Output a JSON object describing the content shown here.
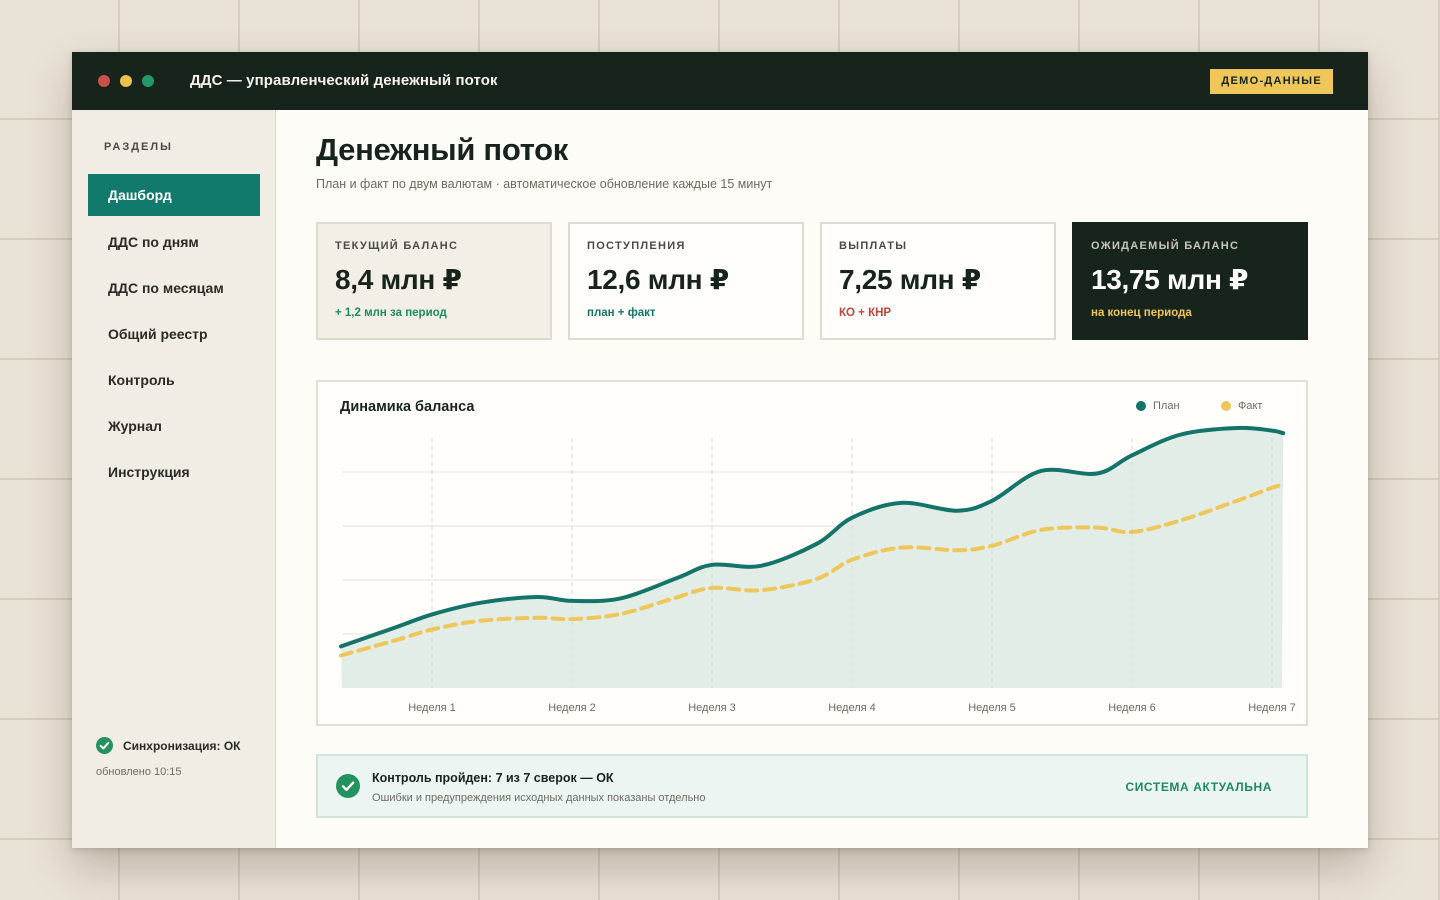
{
  "window": {
    "title": "ДДС — управленческий денежный поток",
    "badge": "ДЕМО-ДАННЫЕ"
  },
  "sidebar": {
    "heading": "РАЗДЕЛЫ",
    "items": [
      {
        "label": "Дашборд",
        "active": true
      },
      {
        "label": "ДДС по дням"
      },
      {
        "label": "ДДС по месяцам"
      },
      {
        "label": "Общий реестр"
      },
      {
        "label": "Контроль"
      },
      {
        "label": "Журнал"
      },
      {
        "label": "Инструкция"
      }
    ],
    "sync": {
      "status": "Синхронизация: ОК",
      "updated": "обновлено 10:15"
    }
  },
  "main": {
    "title": "Денежный поток",
    "subtitle": "План и факт по двум валютам · автоматическое обновление каждые 15 минут",
    "kpis": [
      {
        "label": "ТЕКУЩИЙ БАЛАНС",
        "value": "8,4 млн ₽",
        "note": "+ 1,2 млн за период"
      },
      {
        "label": "ПОСТУПЛЕНИЯ",
        "value": "12,6 млн ₽",
        "note": "план + факт"
      },
      {
        "label": "ВЫПЛАТЫ",
        "value": "7,25 млн ₽",
        "note": "КО + КНР"
      },
      {
        "label": "ОЖИДАЕМЫЙ БАЛАНС",
        "value": "13,75 млн ₽",
        "note": "на конец периода"
      }
    ],
    "status": {
      "title": "Контроль пройден: 7 из 7 сверок — ОК",
      "description": "Ошибки и предупреждения исходных данных показаны отдельно",
      "state": "СИСТЕМА АКТУАЛЬНА"
    }
  },
  "colors": {
    "plan": "#147469",
    "fact": "#eec659",
    "area": "#e3ede7",
    "accent": "#117a6c",
    "dark": "#17241c"
  },
  "chart_data": {
    "type": "line",
    "title": "Динамика баланса",
    "legend_position": "top-right",
    "grid": true,
    "categories": [
      "Неделя 1",
      "Неделя 2",
      "Неделя 3",
      "Неделя 4",
      "Неделя 5",
      "Неделя 6",
      "Неделя 7"
    ],
    "x": [
      -0.65,
      -0.25,
      0,
      0.35,
      0.75,
      1,
      1.35,
      1.75,
      2,
      2.35,
      2.75,
      3,
      3.35,
      3.75,
      4,
      4.35,
      4.75,
      5,
      5.35,
      5.75,
      6,
      6.08
    ],
    "ylim": [
      0,
      1
    ],
    "series": [
      {
        "name": "План",
        "style": "solid",
        "area": true,
        "values": [
          0.16,
          0.235,
          0.283,
          0.328,
          0.35,
          0.335,
          0.345,
          0.423,
          0.474,
          0.47,
          0.555,
          0.655,
          0.712,
          0.682,
          0.72,
          0.835,
          0.825,
          0.895,
          0.975,
          1.0,
          0.99,
          0.98
        ]
      },
      {
        "name": "Факт",
        "style": "dashed",
        "values": [
          0.125,
          0.185,
          0.225,
          0.259,
          0.27,
          0.265,
          0.285,
          0.349,
          0.385,
          0.376,
          0.42,
          0.493,
          0.54,
          0.53,
          0.547,
          0.608,
          0.617,
          0.6,
          0.645,
          0.72,
          0.77,
          0.783
        ]
      }
    ]
  }
}
